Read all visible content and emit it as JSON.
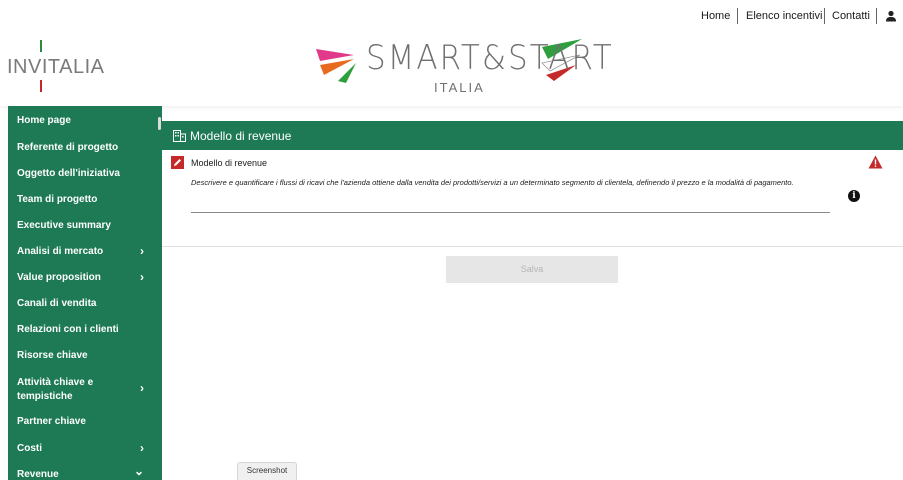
{
  "top_nav": {
    "home": "Home",
    "incentives": "Elenco incentivi",
    "contacts": "Contatti",
    "user_icon": "user-icon"
  },
  "logo": {
    "invitalia": "INVITALIA",
    "smart_start": "SMART&START",
    "smart_start_sub": "ITALIA"
  },
  "sidebar": {
    "items": [
      {
        "label": "Home page",
        "has_chevron": false
      },
      {
        "label": "Referente di progetto",
        "has_chevron": false
      },
      {
        "label": "Oggetto dell'iniziativa",
        "has_chevron": false
      },
      {
        "label": "Team di progetto",
        "has_chevron": false
      },
      {
        "label": "Executive summary",
        "has_chevron": false
      },
      {
        "label": "Analisi di mercato",
        "has_chevron": true,
        "chevron": "›"
      },
      {
        "label": "Value proposition",
        "has_chevron": true,
        "chevron": "›"
      },
      {
        "label": "Canali di vendita",
        "has_chevron": false
      },
      {
        "label": "Relazioni con i clienti",
        "has_chevron": false
      },
      {
        "label": "Risorse chiave",
        "has_chevron": false
      },
      {
        "label": "Attività chiave e",
        "label2": "tempistiche",
        "has_chevron": true,
        "chevron": "›"
      },
      {
        "label": "Partner chiave",
        "has_chevron": false
      },
      {
        "label": "Costi",
        "has_chevron": true,
        "chevron": "›"
      },
      {
        "label": "Revenue",
        "has_chevron": true,
        "chevron": "⌄"
      }
    ]
  },
  "main": {
    "section_title": "Modello di revenue",
    "field_title": "Modello di revenue",
    "field_description": "Descrivere e quantificare i flussi di ricavi che l'azienda ottiene dalla vendita dei prodotti/servizi a un determinato segmento di clientela, definendo il prezzo e la modalità di pagamento.",
    "field_value": "",
    "info_glyph": "i",
    "save_label": "Salva"
  },
  "footer": {
    "screenshot_tab": "Screenshot"
  },
  "colors": {
    "brand_green": "#1d7a55",
    "warning_red": "#c52a2a"
  }
}
